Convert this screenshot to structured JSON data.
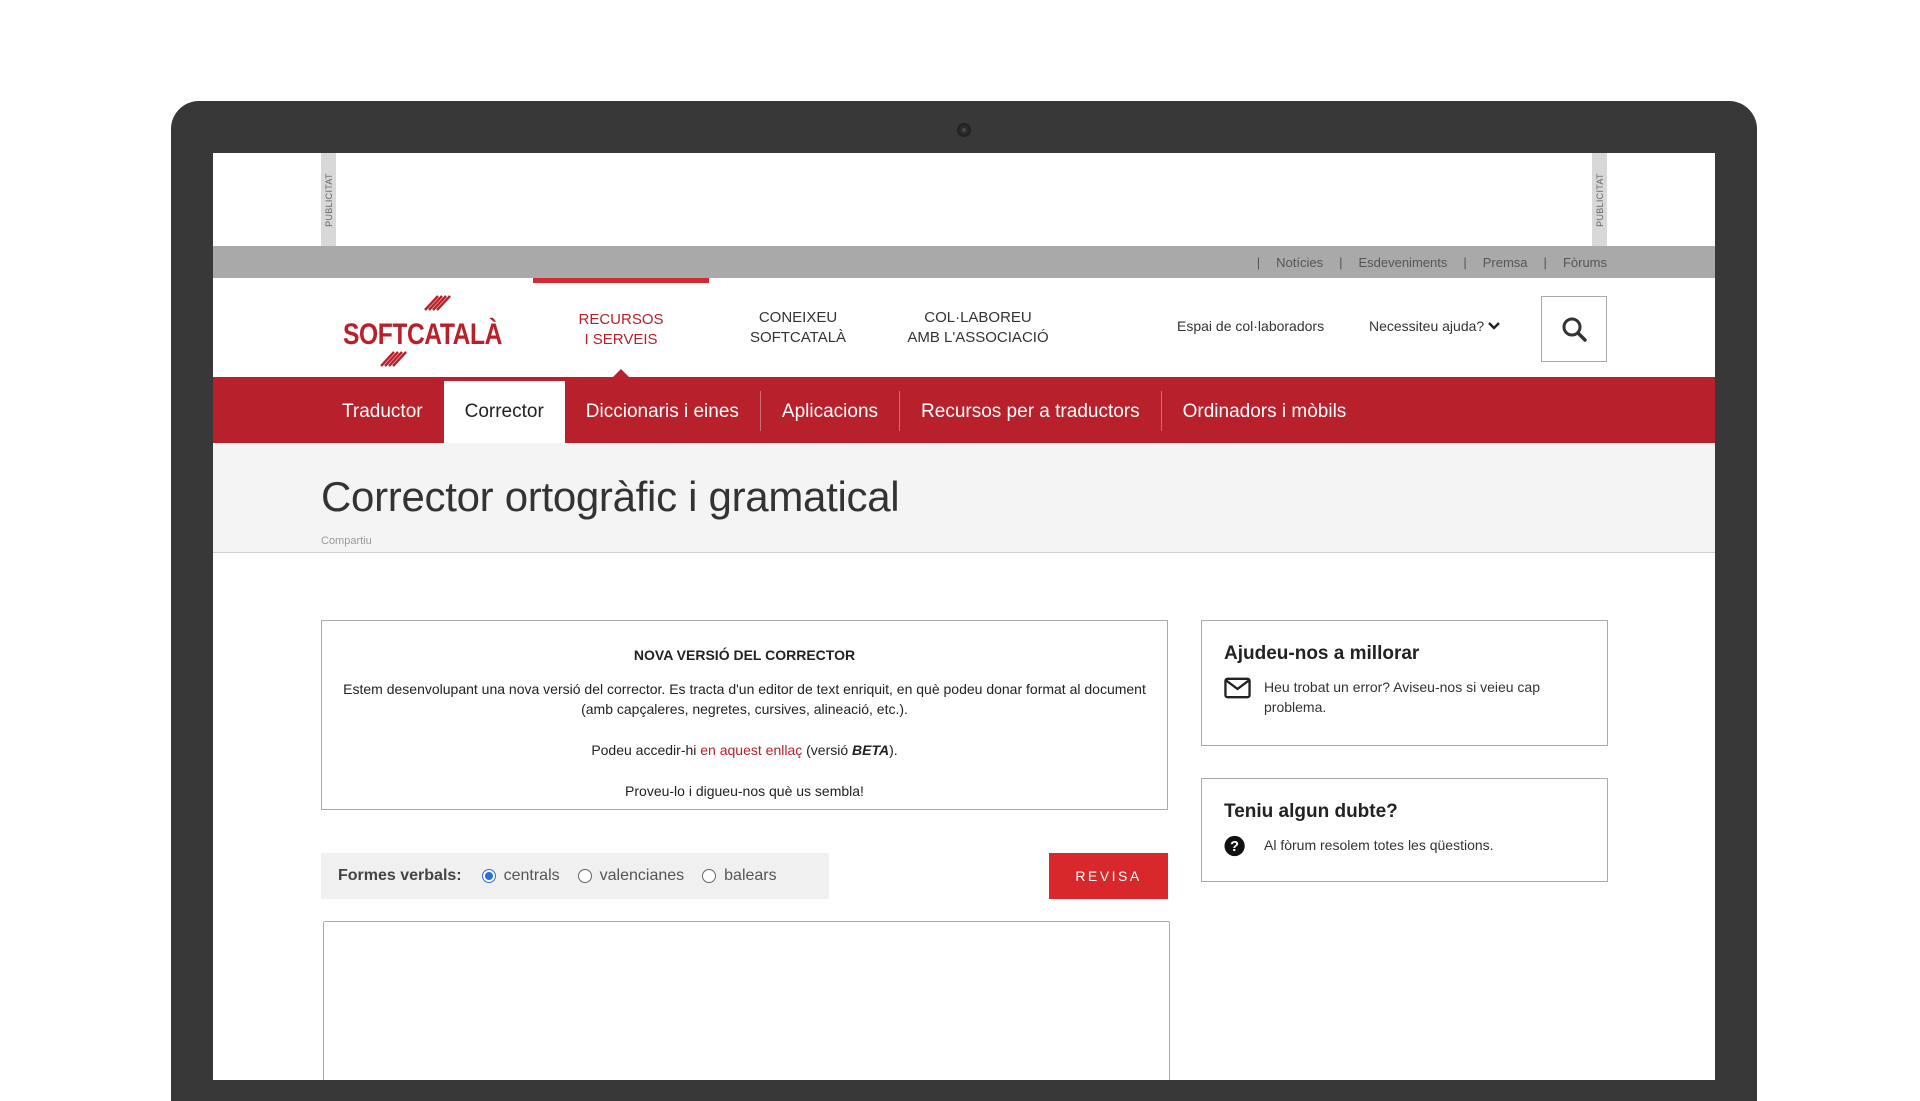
{
  "ads": {
    "label": "PUBLICITAT"
  },
  "topbar": {
    "links": [
      "Notícies",
      "Esdeveniments",
      "Premsa",
      "Fòrums"
    ]
  },
  "header": {
    "logo_text": "SOFTCATALÀ",
    "nav": [
      {
        "line1": "RECURSOS",
        "line2": "I SERVEIS"
      },
      {
        "line1": "CONEIXEU",
        "line2": "SOFTCATALÀ"
      },
      {
        "line1": "COL·LABOREU",
        "line2": "AMB L'ASSOCIACIÓ"
      }
    ],
    "collaborators_link": "Espai de col·laboradors",
    "help_link": "Necessiteu ajuda?"
  },
  "subnav": {
    "items": [
      "Traductor",
      "Corrector",
      "Diccionaris i eines",
      "Aplicacions",
      "Recursos per a traductors",
      "Ordinadors i mòbils"
    ]
  },
  "page": {
    "title": "Corrector ortogràfic i gramatical",
    "share": "Compartiu"
  },
  "notice": {
    "title": "NOVA VERSIÓ DEL CORRECTOR",
    "body": "Estem desenvolupant una nova versió del corrector. Es tracta d'un editor de text enriquit, en què podeu donar format al document (amb capçaleres, negretes, cursives, alineació, etc.).",
    "access_prefix": "Podeu accedir-hi ",
    "access_link": "en aquest enllaç",
    "access_mid": " (versió ",
    "access_beta": "BETA",
    "access_suffix": ").",
    "closing": "Proveu-lo i digueu-nos què us sembla!"
  },
  "forms": {
    "label": "Formes verbals:",
    "options": [
      "centrals",
      "valencianes",
      "balears"
    ],
    "selected": "centrals"
  },
  "revisa_button": "REVISA",
  "sidebar": {
    "improve": {
      "title": "Ajudeu-nos a millorar",
      "text": "Heu trobat un error? Aviseu-nos si veieu cap problema."
    },
    "doubt": {
      "title": "Teniu algun dubte?",
      "text": "Al fòrum resolem totes les qüestions."
    }
  }
}
